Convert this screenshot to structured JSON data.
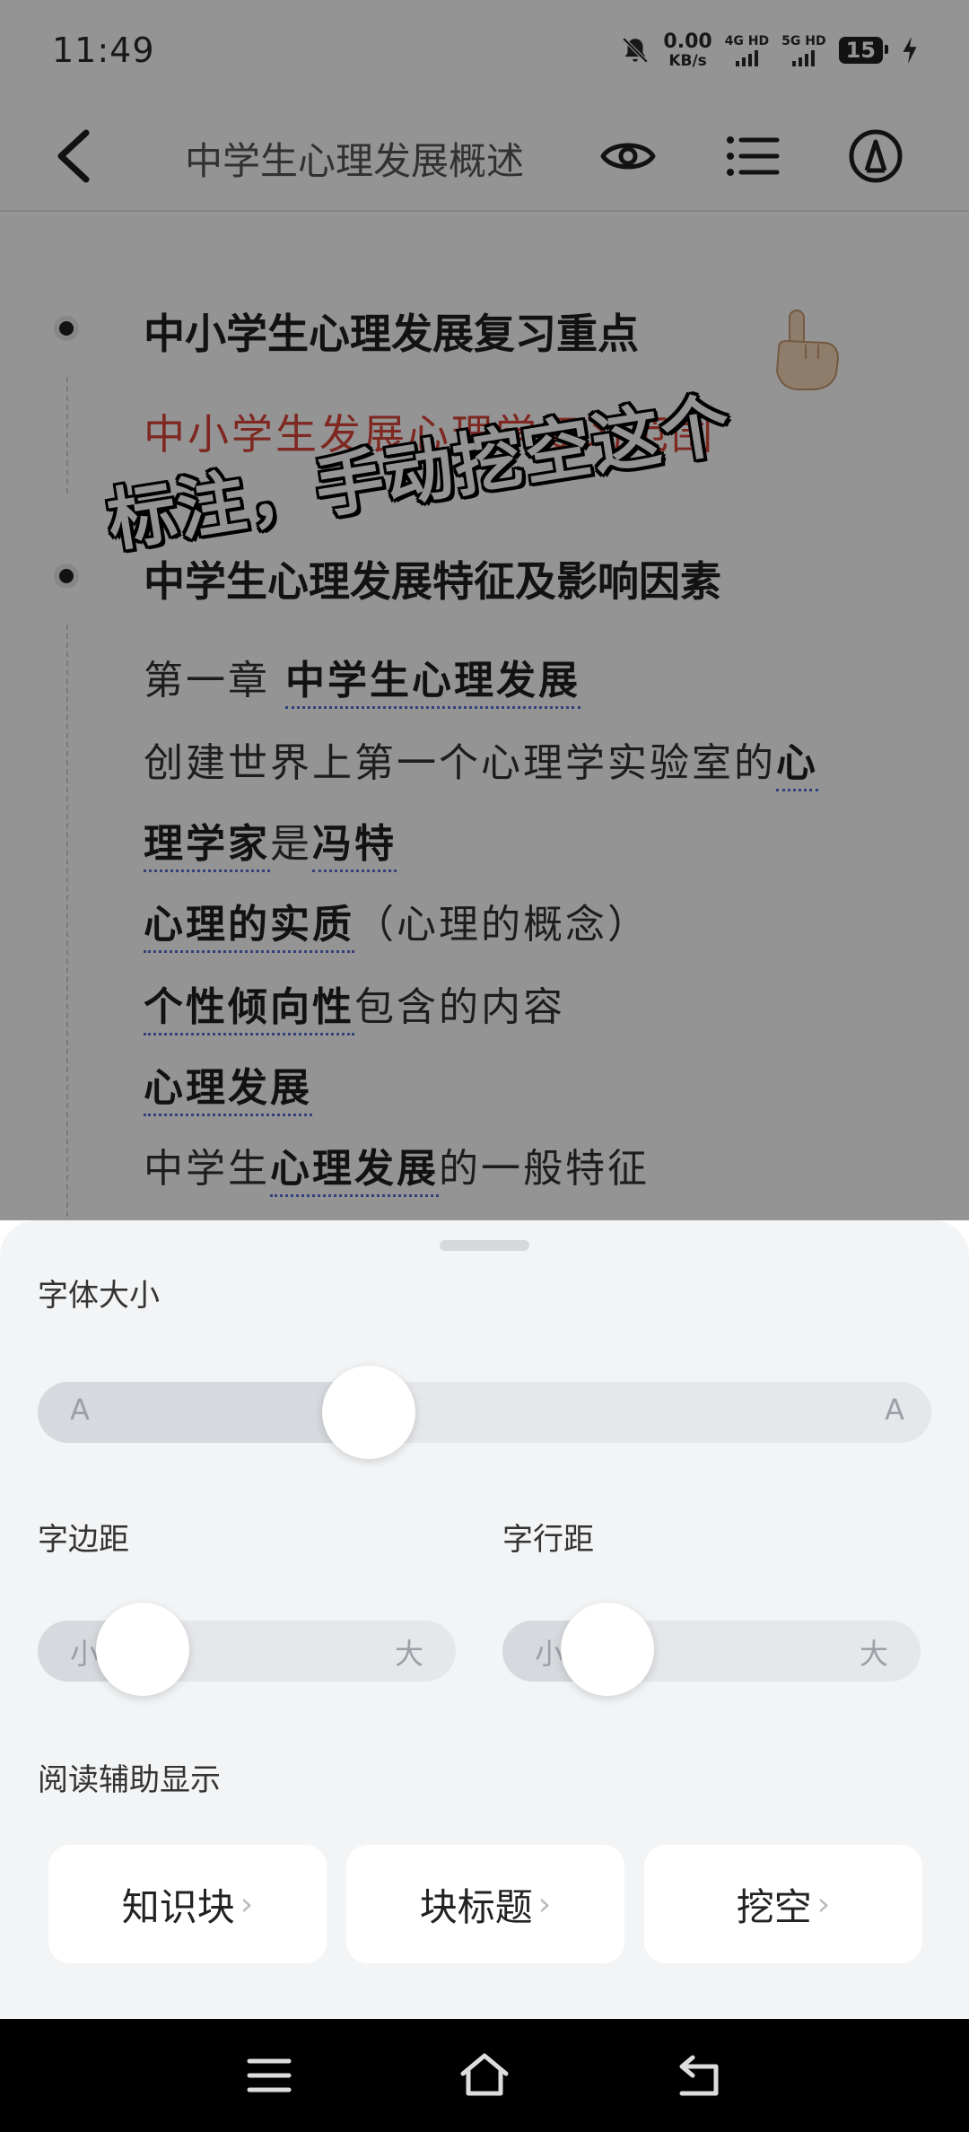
{
  "status_bar": {
    "time": "11:49",
    "net_speed_value": "0.00",
    "net_speed_unit": "KB/s",
    "sim1_label": "4G HD",
    "sim2_label": "5G HD",
    "battery": "15",
    "icons": [
      "mute-bell-icon",
      "signal-icon",
      "battery-icon",
      "charging-icon"
    ]
  },
  "nav": {
    "title": "中学生心理发展概述",
    "icons": [
      "back-arrow-icon",
      "eye-icon",
      "list-icon",
      "pen-icon"
    ]
  },
  "doc": {
    "bullet1_heading": "中小学生心理发展复习重点",
    "bullet1_sub": "中小学生发展心理学复习范围",
    "bullet2_heading": "中学生心理发展特征及影响因素",
    "line1_pre": "第一章 ",
    "line1_term": "中学生心理发展",
    "line2_pre": "创建世界上第一个心理学实验室的",
    "line2_term": "心",
    "line3_term1": "理学家",
    "line3_mid": "是",
    "line3_term2": "冯特",
    "line4_term": "心理的实质",
    "line4_post": "（心理的概念）",
    "line5_term": "个性倾向性",
    "line5_post": "包含的内容",
    "line6_term": "心理发展",
    "line7_pre": "中学生",
    "line7_term": "心理发展",
    "line7_post": "的一般特征"
  },
  "overlay": {
    "caption": "标注，手动挖空这个",
    "emoji": "pointing-hand"
  },
  "settings": {
    "font_size_label": "字体大小",
    "font_size_min": "A",
    "font_size_max": "A",
    "font_size_level": 0.37,
    "char_spacing_label": "字边距",
    "char_spacing_min": "小",
    "char_spacing_max": "大",
    "char_spacing_level": 0.25,
    "line_spacing_label": "字行距",
    "line_spacing_min": "小",
    "line_spacing_max": "大",
    "line_spacing_level": 0.25,
    "reading_aid_label": "阅读辅助显示",
    "options": [
      "知识块",
      "块标题",
      "挖空"
    ],
    "chevron": "›"
  },
  "sys_nav": {
    "icons": [
      "menu-icon",
      "home-icon",
      "back-icon"
    ]
  }
}
